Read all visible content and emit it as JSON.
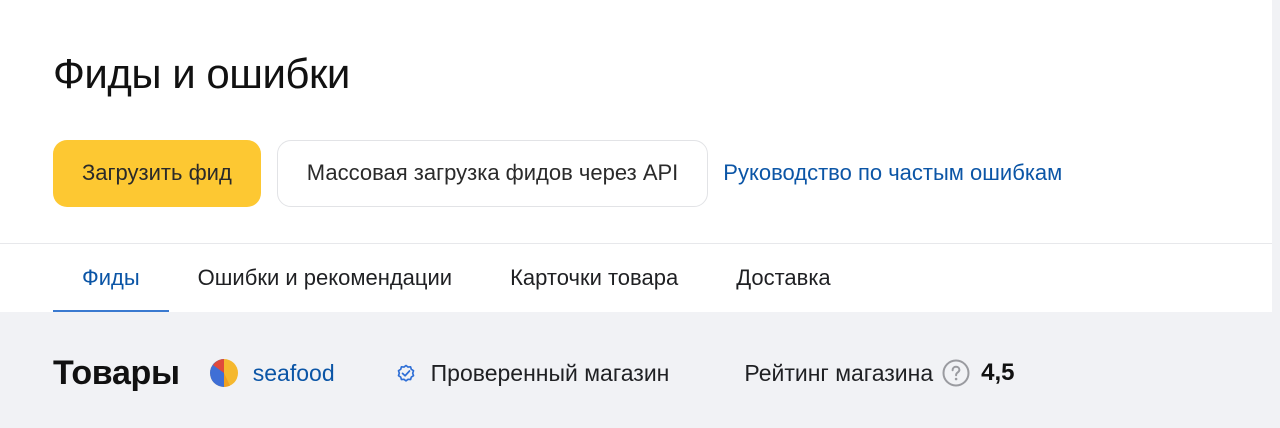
{
  "header": {
    "title": "Фиды и ошибки"
  },
  "actions": {
    "upload_label": "Загрузить фид",
    "bulk_api_label": "Массовая загрузка фидов через API",
    "guide_link": "Руководство по частым ошибкам"
  },
  "tabs": [
    {
      "label": "Фиды",
      "active": true
    },
    {
      "label": "Ошибки и рекомендации",
      "active": false
    },
    {
      "label": "Карточки товара",
      "active": false
    },
    {
      "label": "Доставка",
      "active": false
    }
  ],
  "summary": {
    "title": "Товары",
    "shop_name": "seafood",
    "verified_label": "Проверенный магазин",
    "rating_label": "Рейтинг магазина",
    "rating_value": "4,5"
  },
  "icons": {
    "shop_logo": "shop-logo-icon",
    "verified": "verified-badge-icon",
    "help": "question-circle-icon"
  },
  "colors": {
    "primary_button": "#fdc832",
    "link": "#0b55a6",
    "background_gray": "#f1f2f5"
  }
}
